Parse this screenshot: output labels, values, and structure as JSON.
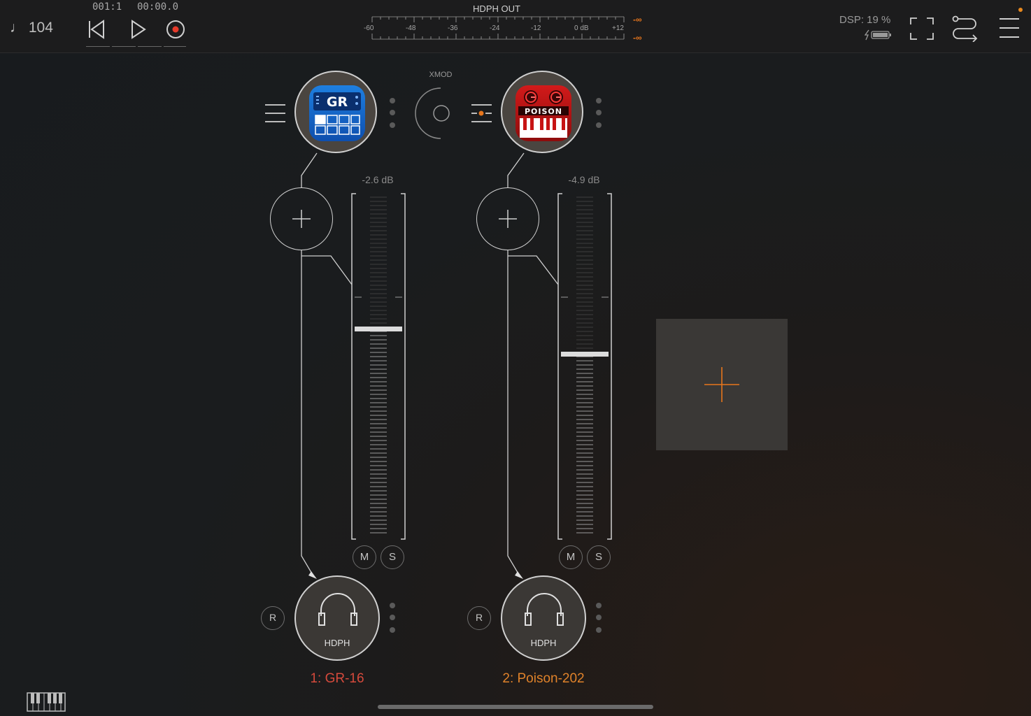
{
  "transport": {
    "tempo_icon": "note-icon",
    "tempo": "104",
    "position_bars": "001:1",
    "position_time": "00:00.0"
  },
  "output_meter": {
    "title": "HDPH OUT",
    "scale": [
      "-60",
      "-48",
      "-36",
      "-24",
      "-12",
      "0 dB",
      "+12"
    ],
    "peak_left": "-∞",
    "peak_right": "-∞"
  },
  "status": {
    "dsp": "DSP: 19 %",
    "battery_icon": "battery-charging-icon",
    "notification_color": "#e8891e"
  },
  "xmod_label": "XMOD",
  "channels": [
    {
      "name": "1: GR-16",
      "name_color": "#d64a3c",
      "plugin": "GR",
      "volume_db": "-2.6 dB",
      "mute": "M",
      "solo": "S",
      "record": "R",
      "destination": "HDPH"
    },
    {
      "name": "2: Poison-202",
      "name_color": "#e0822a",
      "plugin": "POISON",
      "volume_db": "-4.9 dB",
      "mute": "M",
      "solo": "S",
      "record": "R",
      "destination": "HDPH"
    }
  ],
  "accent_color": "#e8761c"
}
